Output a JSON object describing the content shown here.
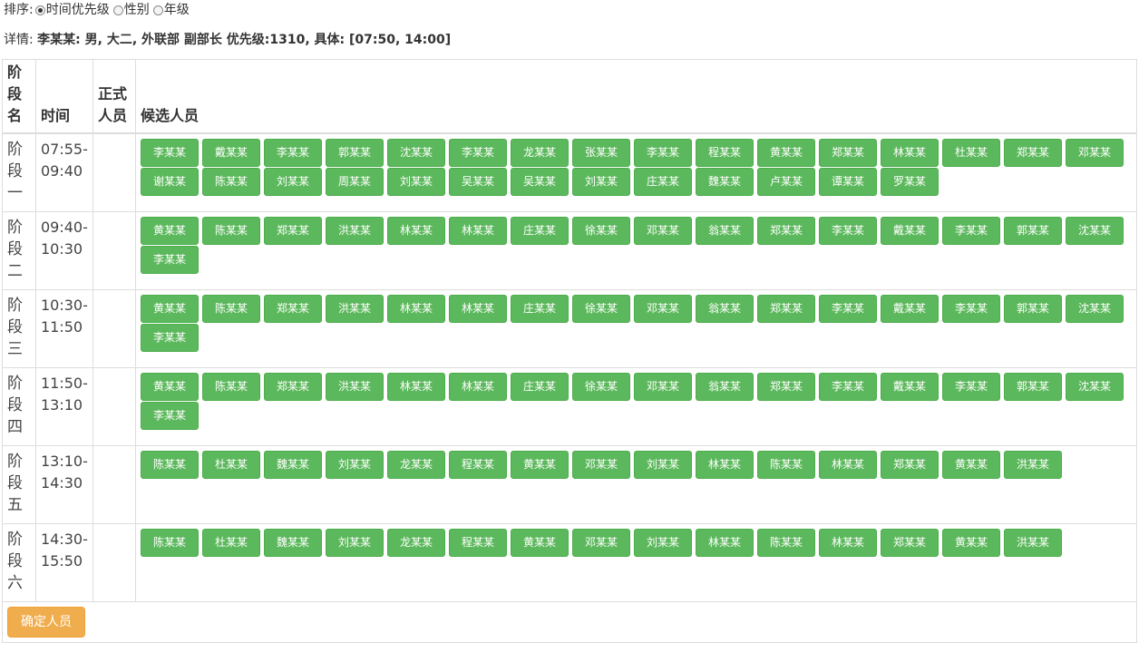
{
  "sort": {
    "label": "排序:",
    "options": [
      {
        "label": "时间优先级",
        "checked": true
      },
      {
        "label": "性别",
        "checked": false
      },
      {
        "label": "年级",
        "checked": false
      }
    ]
  },
  "detail": {
    "prefix": "详情:",
    "text": "李某某: 男, 大二, 外联部 副部长 优先级:1310, 具体: [07:50, 14:00]"
  },
  "table": {
    "headers": {
      "stage": "阶段名",
      "time": "时间",
      "formal": "正式人员",
      "candidates": "候选人员"
    },
    "rows": [
      {
        "stage": "阶段一",
        "time": "07:55-09:40",
        "formal": "",
        "candidates": [
          "李某某",
          "戴某某",
          "李某某",
          "郭某某",
          "沈某某",
          "李某某",
          "龙某某",
          "张某某",
          "李某某",
          "程某某",
          "黄某某",
          "郑某某",
          "林某某",
          "杜某某",
          "郑某某",
          "邓某某",
          "谢某某",
          "陈某某",
          "刘某某",
          "周某某",
          "刘某某",
          "吴某某",
          "吴某某",
          "刘某某",
          "庄某某",
          "魏某某",
          "卢某某",
          "谭某某",
          "罗某某"
        ]
      },
      {
        "stage": "阶段二",
        "time": "09:40-10:30",
        "formal": "",
        "candidates": [
          "黄某某",
          "陈某某",
          "郑某某",
          "洪某某",
          "林某某",
          "林某某",
          "庄某某",
          "徐某某",
          "邓某某",
          "翁某某",
          "郑某某",
          "李某某",
          "戴某某",
          "李某某",
          "郭某某",
          "沈某某",
          "李某某"
        ]
      },
      {
        "stage": "阶段三",
        "time": "10:30-11:50",
        "formal": "",
        "candidates": [
          "黄某某",
          "陈某某",
          "郑某某",
          "洪某某",
          "林某某",
          "林某某",
          "庄某某",
          "徐某某",
          "邓某某",
          "翁某某",
          "郑某某",
          "李某某",
          "戴某某",
          "李某某",
          "郭某某",
          "沈某某",
          "李某某"
        ]
      },
      {
        "stage": "阶段四",
        "time": "11:50-13:10",
        "formal": "",
        "candidates": [
          "黄某某",
          "陈某某",
          "郑某某",
          "洪某某",
          "林某某",
          "林某某",
          "庄某某",
          "徐某某",
          "邓某某",
          "翁某某",
          "郑某某",
          "李某某",
          "戴某某",
          "李某某",
          "郭某某",
          "沈某某",
          "李某某"
        ]
      },
      {
        "stage": "阶段五",
        "time": "13:10-14:30",
        "formal": "",
        "candidates": [
          "陈某某",
          "杜某某",
          "魏某某",
          "刘某某",
          "龙某某",
          "程某某",
          "黄某某",
          "邓某某",
          "刘某某",
          "林某某",
          "陈某某",
          "林某某",
          "郑某某",
          "黄某某",
          "洪某某"
        ]
      },
      {
        "stage": "阶段六",
        "time": "14:30-15:50",
        "formal": "",
        "candidates": [
          "陈某某",
          "杜某某",
          "魏某某",
          "刘某某",
          "龙某某",
          "程某某",
          "黄某某",
          "邓某某",
          "刘某某",
          "林某某",
          "陈某某",
          "林某某",
          "郑某某",
          "黄某某",
          "洪某某"
        ]
      }
    ]
  },
  "footer": {
    "confirm_label": "确定人员"
  },
  "colors": {
    "candidate_button": "#5cb85c",
    "confirm_button": "#f0ad4e"
  }
}
